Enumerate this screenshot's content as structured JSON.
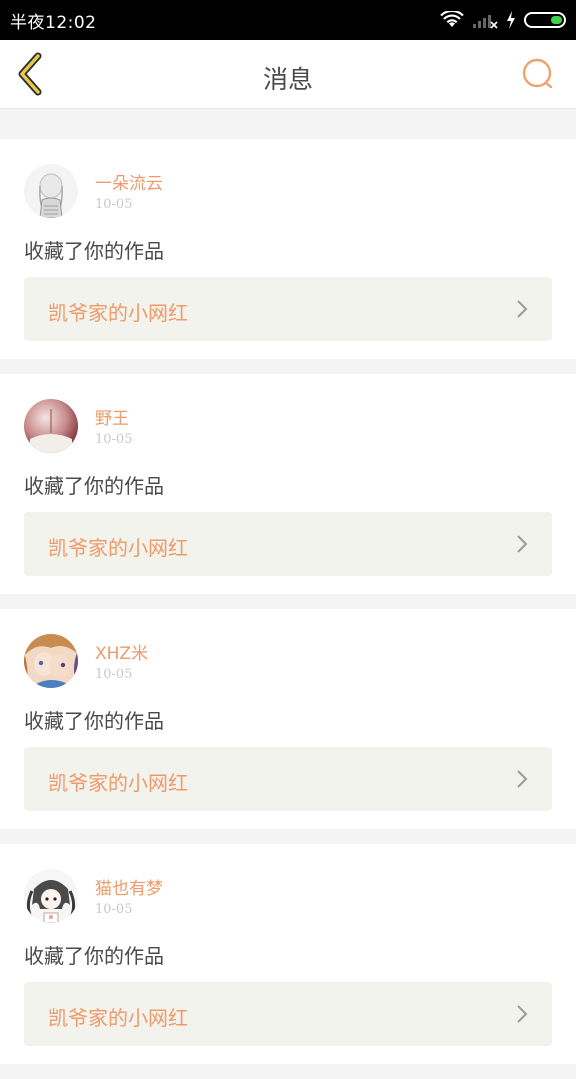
{
  "status_bar": {
    "time": "半夜12:02"
  },
  "header": {
    "title": "消息",
    "back_icon": "chevron-left-icon",
    "search_icon": "search-icon"
  },
  "colors": {
    "accent": "#ee9a6a",
    "back": "#e8c84a",
    "card_link_bg": "#f3f3ed"
  },
  "messages": [
    {
      "username": "一朵流云",
      "date": "10-05",
      "action": "收藏了你的作品",
      "work_title": "凯爷家的小网红"
    },
    {
      "username": "野王",
      "date": "10-05",
      "action": "收藏了你的作品",
      "work_title": "凯爷家的小网红"
    },
    {
      "username": "XHZ米",
      "date": "10-05",
      "action": "收藏了你的作品",
      "work_title": "凯爷家的小网红"
    },
    {
      "username": "猫也有梦",
      "date": "10-05",
      "action": "收藏了你的作品",
      "work_title": "凯爷家的小网红"
    }
  ]
}
